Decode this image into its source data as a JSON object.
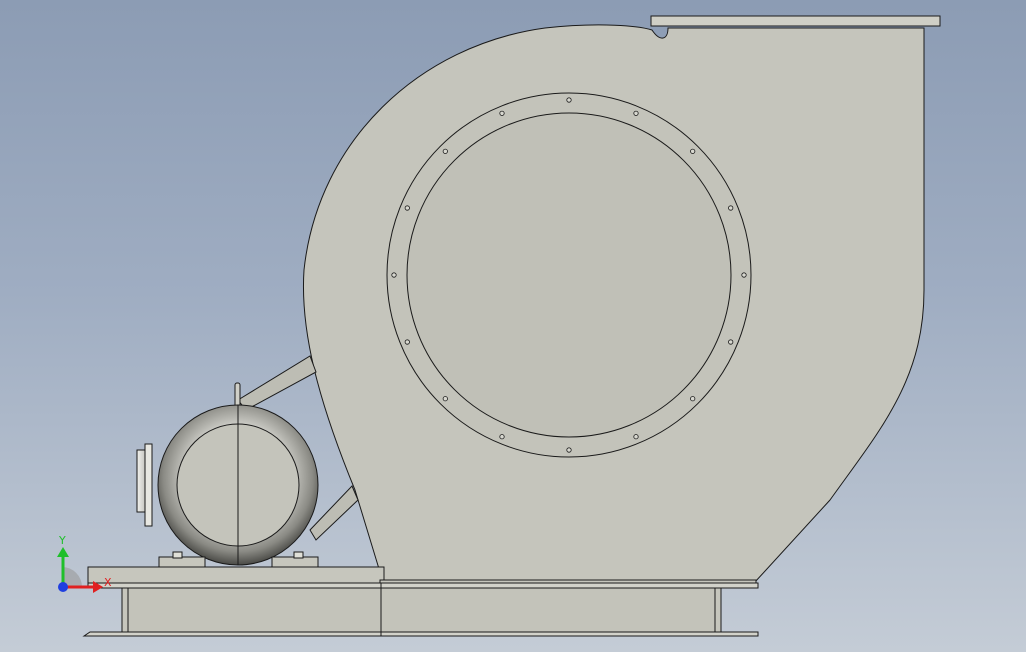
{
  "viewport": {
    "background_top": "#8c9cb4",
    "background_bottom": "#c4ccd6"
  },
  "model": {
    "body_color": "#c6c6bd",
    "edge_color": "#1a1a1a",
    "inlet_flange_bolt_count": 16
  },
  "triad": {
    "y_label": "Y",
    "x_label": "X",
    "y_color": "#1fbf2a",
    "x_color": "#e02020",
    "z_color": "#1f3fe0"
  }
}
